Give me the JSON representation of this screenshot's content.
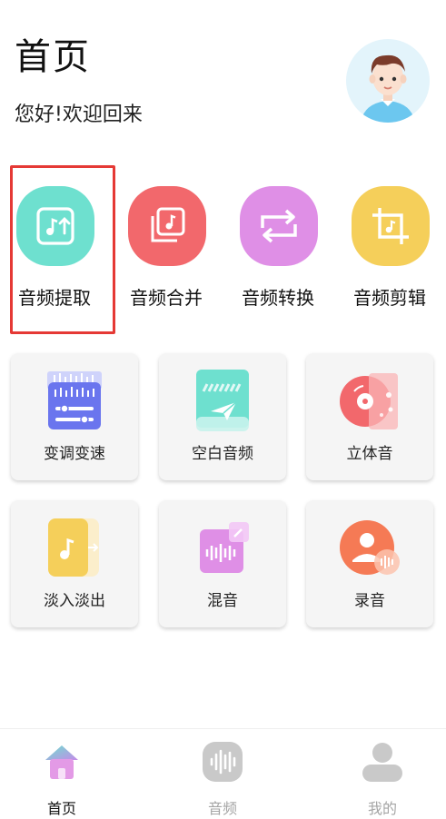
{
  "header": {
    "title": "首页",
    "greeting": "您好!欢迎回来"
  },
  "features": [
    {
      "label": "音频提取",
      "icon": "music-export-icon",
      "color": "#6ee0cf",
      "selected": true
    },
    {
      "label": "音频合并",
      "icon": "music-stack-icon",
      "color": "#f2686c",
      "selected": false
    },
    {
      "label": "音频转换",
      "icon": "repeat-icon",
      "color": "#df8fe6",
      "selected": false
    },
    {
      "label": "音频剪辑",
      "icon": "crop-icon",
      "color": "#f5cf5a",
      "selected": false
    }
  ],
  "tools": [
    {
      "label": "变调变速",
      "icon": "equalizer-icon",
      "color": "#6a75ee"
    },
    {
      "label": "空白音频",
      "icon": "paper-plane-icon",
      "color": "#6ee0cf"
    },
    {
      "label": "立体音",
      "icon": "stereo-disc-icon",
      "color": "#f2686c"
    },
    {
      "label": "淡入淡出",
      "icon": "fade-music-icon",
      "color": "#f5cf5a"
    },
    {
      "label": "混音",
      "icon": "mix-waveform-icon",
      "color": "#df8fe6"
    },
    {
      "label": "录音",
      "icon": "record-user-icon",
      "color": "#f57a55"
    }
  ],
  "tabs": [
    {
      "label": "首页",
      "icon": "home-icon",
      "active": true
    },
    {
      "label": "音频",
      "icon": "waveform-icon",
      "active": false
    },
    {
      "label": "我的",
      "icon": "user-icon",
      "active": false
    }
  ],
  "colors": {
    "highlight": "#e53935",
    "tab_active": "#111111",
    "tab_inactive": "#a5a5a5"
  }
}
